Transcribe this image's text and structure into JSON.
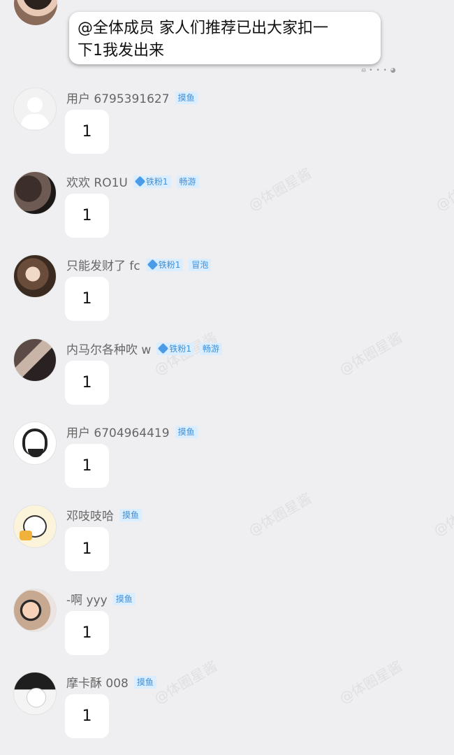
{
  "watermark": "@体圈星酱",
  "top_message": {
    "text_line1": "@全体成员 家人们推荐已出大家扣一",
    "text_line2": "下1我发出来",
    "meta": "ഒ • • • ◕"
  },
  "messages": [
    {
      "name": "用户 6795391627",
      "badges": [
        {
          "text": "摸鱼",
          "fan": false
        }
      ],
      "text": "1",
      "avatar": "default-user-icon"
    },
    {
      "name": "欢欢 RO1U",
      "badges": [
        {
          "text": "铁粉1",
          "fan": true
        },
        {
          "text": "畅游",
          "fan": false
        }
      ],
      "text": "1",
      "avatar": "photo-avatar"
    },
    {
      "name": "只能发财了 fc",
      "badges": [
        {
          "text": "铁粉1",
          "fan": true
        },
        {
          "text": "冒泡",
          "fan": false
        }
      ],
      "text": "1",
      "avatar": "photo-avatar"
    },
    {
      "name": "内马尔各种吹 w",
      "badges": [
        {
          "text": "铁粉1",
          "fan": true
        },
        {
          "text": "畅游",
          "fan": false
        }
      ],
      "text": "1",
      "avatar": "photo-avatar"
    },
    {
      "name": "用户 6704964419",
      "badges": [
        {
          "text": "摸鱼",
          "fan": false
        }
      ],
      "text": "1",
      "avatar": "cartoon-avatar"
    },
    {
      "name": "邓吱吱哈",
      "badges": [
        {
          "text": "摸鱼",
          "fan": false
        }
      ],
      "text": "1",
      "avatar": "cartoon-dog-avatar"
    },
    {
      "name": "-啊 yyy",
      "badges": [
        {
          "text": "摸鱼",
          "fan": false
        }
      ],
      "text": "1",
      "avatar": "photo-avatar"
    },
    {
      "name": "摩卡酥 008",
      "badges": [
        {
          "text": "摸鱼",
          "fan": false
        }
      ],
      "text": "1",
      "avatar": "photo-avatar"
    }
  ]
}
